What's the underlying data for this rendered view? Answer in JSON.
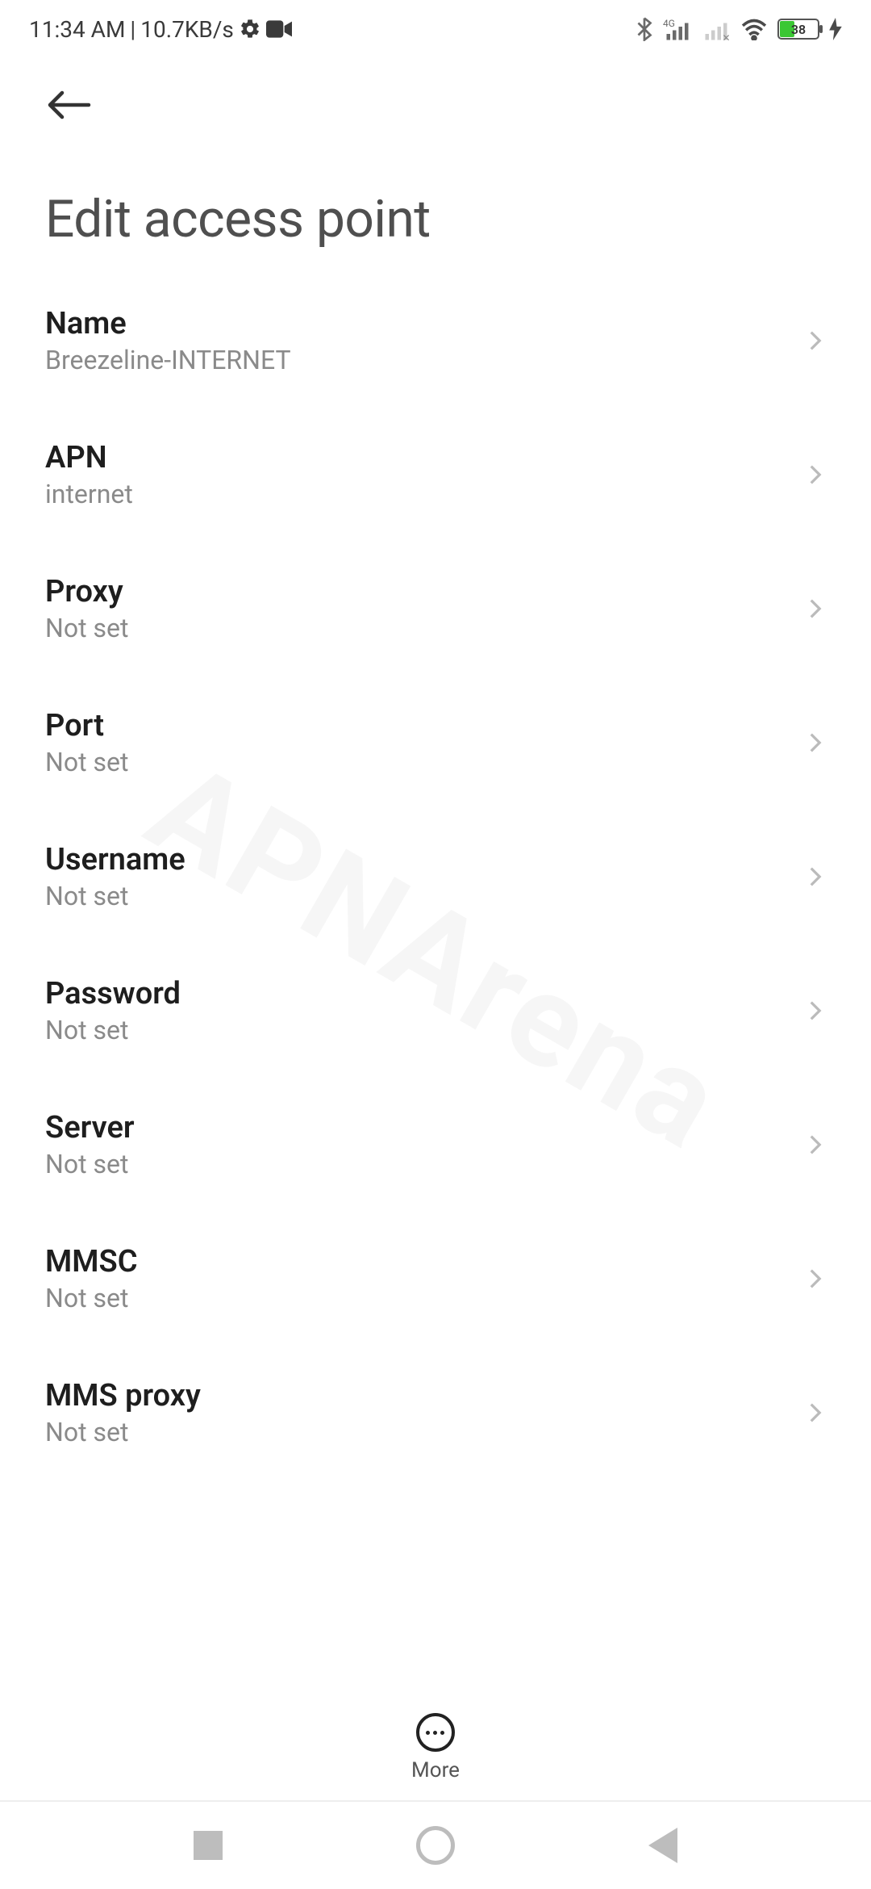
{
  "status": {
    "time": "11:34 AM",
    "speed": "10.7KB/s",
    "battery": "38"
  },
  "header": {
    "title": "Edit access point"
  },
  "settings": [
    {
      "label": "Name",
      "value": "Breezeline-INTERNET"
    },
    {
      "label": "APN",
      "value": "internet"
    },
    {
      "label": "Proxy",
      "value": "Not set"
    },
    {
      "label": "Port",
      "value": "Not set"
    },
    {
      "label": "Username",
      "value": "Not set"
    },
    {
      "label": "Password",
      "value": "Not set"
    },
    {
      "label": "Server",
      "value": "Not set"
    },
    {
      "label": "MMSC",
      "value": "Not set"
    },
    {
      "label": "MMS proxy",
      "value": "Not set"
    }
  ],
  "bottom": {
    "more": "More"
  },
  "watermark": "APNArena"
}
